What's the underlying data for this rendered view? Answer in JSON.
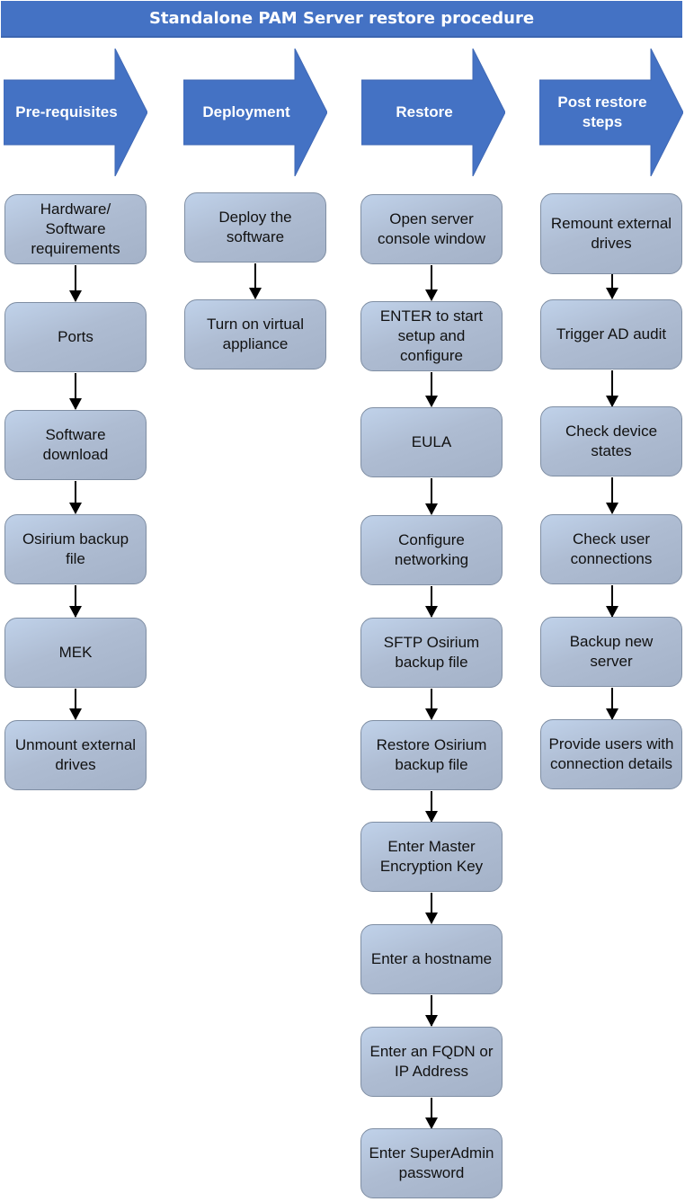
{
  "title": "Standalone PAM Server restore procedure",
  "colors": {
    "banner": "#4472C4",
    "arrow": "#4472C4",
    "box_fill": "#B4C3DA",
    "box_border": "#7F8EA3",
    "connector": "#000000"
  },
  "columns": [
    {
      "phase": "Pre-requisites",
      "steps": [
        "Hardware/ Software requirements",
        "Ports",
        "Software download",
        "Osirium backup file",
        "MEK",
        "Unmount external drives"
      ]
    },
    {
      "phase": "Deployment",
      "steps": [
        "Deploy the software",
        "Turn on virtual appliance"
      ]
    },
    {
      "phase": "Restore",
      "steps": [
        "Open server console window",
        "ENTER to start setup and configure",
        "EULA",
        "Configure networking",
        "SFTP Osirium backup file",
        "Restore Osirium backup file",
        "Enter Master Encryption Key",
        "Enter a hostname",
        "Enter an FQDN or IP Address",
        "Enter SuperAdmin password"
      ]
    },
    {
      "phase": "Post restore steps",
      "steps": [
        "Remount external drives",
        "Trigger AD audit",
        "Check device states",
        "Check user connections",
        "Backup new server",
        "Provide users with connection details"
      ]
    }
  ]
}
